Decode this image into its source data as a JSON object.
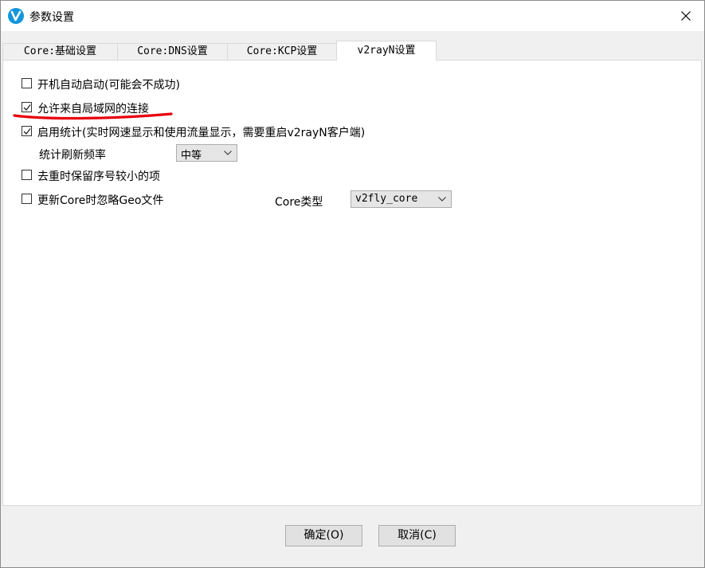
{
  "window": {
    "title": "参数设置",
    "icon": "v2rayn-logo-icon"
  },
  "tabs": [
    {
      "label": "Core:基础设置"
    },
    {
      "label": "Core:DNS设置"
    },
    {
      "label": "Core:KCP设置"
    },
    {
      "label": "v2rayN设置",
      "active": true
    }
  ],
  "settings": {
    "autorun": {
      "label": "开机自动启动(可能会不成功)",
      "checked": false
    },
    "allow_lan": {
      "label": "允许来自局域网的连接",
      "checked": true
    },
    "statistics": {
      "label": "启用统计(实时网速显示和使用流量显示，需要重启v2rayN客户端)",
      "checked": true
    },
    "refresh_rate": {
      "label": "统计刷新频率",
      "value": "中等"
    },
    "keep_old": {
      "label": "去重时保留序号较小的项",
      "checked": false
    },
    "ignore_geo": {
      "label": "更新Core时忽略Geo文件",
      "checked": false
    },
    "core_type": {
      "label": "Core类型",
      "value": "v2fly_core"
    }
  },
  "annotation": {
    "color": "#e8000b"
  },
  "buttons": {
    "ok": "确定(O)",
    "cancel": "取消(C)"
  }
}
